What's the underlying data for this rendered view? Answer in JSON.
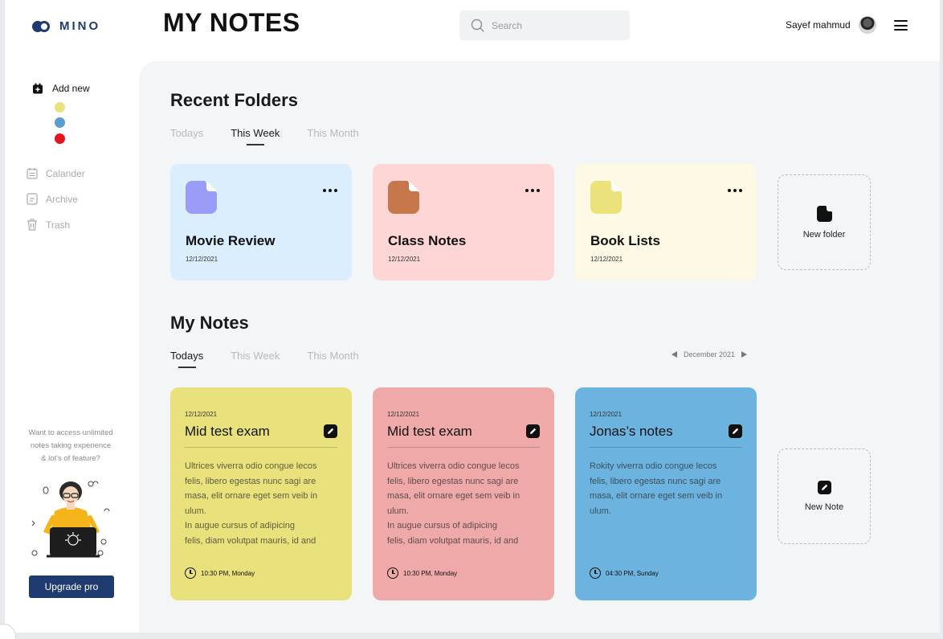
{
  "app": {
    "logo_text": "MINO",
    "page_title": "MY NOTES"
  },
  "search": {
    "placeholder": "Search"
  },
  "user": {
    "name": "Sayef mahmud"
  },
  "sidebar": {
    "add_new_label": "Add new",
    "color_dots": [
      "#ebe27c",
      "#5b9dcd",
      "#e8141c"
    ],
    "items": [
      {
        "label": "Calander",
        "icon": "calendar-icon"
      },
      {
        "label": "Archive",
        "icon": "archive-icon"
      },
      {
        "label": "Trash",
        "icon": "trash-icon"
      }
    ],
    "promo_lines": [
      "Want to access unlimited",
      "notes taking experience",
      "& lot's of feature?"
    ],
    "upgrade_label": "Upgrade pro"
  },
  "recent_folders": {
    "title": "Recent Folders",
    "tabs": [
      "Todays",
      "This Week",
      "This Month"
    ],
    "active_tab": "This Week",
    "folders": [
      {
        "name": "Movie Review",
        "date": "12/12/2021",
        "bg": "#dbeefd",
        "icon_color": "#9b9cf7"
      },
      {
        "name": "Class Notes",
        "date": "12/12/2021",
        "bg": "#ffd6d6",
        "icon_color": "#c7784a"
      },
      {
        "name": "Book Lists",
        "date": "12/12/2021",
        "bg": "#fdf9e4",
        "icon_color": "#ebe27c"
      }
    ],
    "new_folder_label": "New folder"
  },
  "my_notes": {
    "title": "My Notes",
    "tabs": [
      "Todays",
      "This Week",
      "This Month"
    ],
    "active_tab": "Todays",
    "month_label": "December 2021",
    "notes": [
      {
        "date": "12/12/2021",
        "title": "Mid test exam",
        "body": [
          "Ultrices viverra odio congue lecos",
          "felis, libero egestas nunc sagi are",
          "masa, elit ornare eget sem veib in",
          "ulum.",
          "In augue cursus of adipicing",
          "felis, diam volutpat mauris, id and"
        ],
        "time": "10:30 PM, Monday",
        "bg": "#e9e27c"
      },
      {
        "date": "12/12/2021",
        "title": "Mid test exam",
        "body": [
          "Ultrices viverra odio congue lecos",
          "felis, libero egestas nunc sagi are",
          "masa, elit ornare eget sem veib in",
          "ulum.",
          "In augue cursus of adipicing",
          "felis, diam volutpat mauris, id and"
        ],
        "time": "10:30 PM, Monday",
        "bg": "#efa9a9"
      },
      {
        "date": "12/12/2021",
        "title": "Jonas’s notes",
        "body": [
          "Rokity viverra odio congue lecos",
          "felis, libero egestas nunc sagi are",
          "masa, elit ornare eget sem veib in",
          "ulum."
        ],
        "time": "04:30 PM, Sunday",
        "bg": "#6cb3df"
      }
    ],
    "new_note_label": "New Note"
  }
}
